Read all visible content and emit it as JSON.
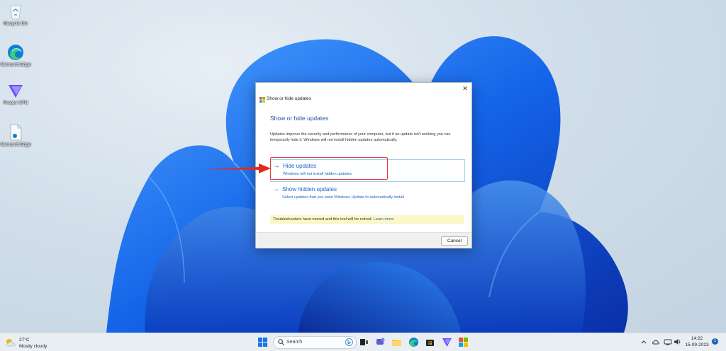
{
  "desktop": {
    "icons": [
      {
        "label": "Recycle Bin"
      },
      {
        "label": "Microsoft Edge"
      },
      {
        "label": "Proton VPN"
      },
      {
        "label": "Microsoft Edge"
      }
    ]
  },
  "dialog": {
    "title": "Show or hide updates",
    "close_glyph": "✕",
    "heading": "Show or hide updates",
    "intro": "Updates improve the security and performance of your computer, but if an update isn't working you can temporarily hide it. Windows will not install hidden updates automatically.",
    "options": [
      {
        "arrow": "→",
        "title": "Hide updates",
        "desc": "Windows will not install hidden updates"
      },
      {
        "arrow": "→",
        "title": "Show hidden updates",
        "desc": "Select updates that you want Windows Update to automatically install"
      }
    ],
    "banner_text": "Troubleshooters have moved and this tool will be retired. ",
    "banner_link": "Learn more.",
    "cancel": "Cancel"
  },
  "taskbar": {
    "weather_temp": "27°C",
    "weather_condition": "Mostly cloudy",
    "search_placeholder": "Search",
    "apps": [
      "start-icon",
      "search",
      "bing-icon",
      "task-view-icon",
      "chat-icon",
      "file-explorer-icon",
      "edge-icon",
      "store-icon",
      "proton-vpn-icon",
      "windows-update-icon"
    ],
    "tray": [
      "chevron-up-icon",
      "cloud-icon",
      "network-icon",
      "volume-icon"
    ],
    "time": "14:22",
    "date": "15-09-2023",
    "notification_count": "1"
  },
  "colors": {
    "accent": "#1c64c8",
    "heading": "#1c4f9c",
    "highlight_box": "#e53a35",
    "banner": "#fbf7c8"
  }
}
